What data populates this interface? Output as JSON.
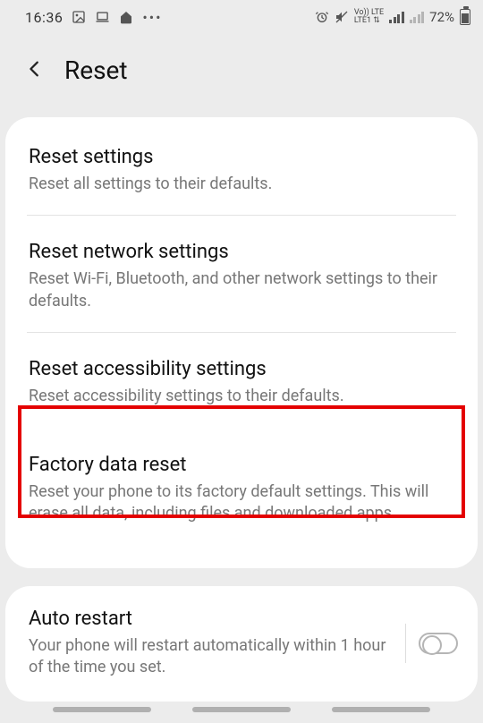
{
  "status": {
    "time": "16:36",
    "battery": "72%",
    "net_label": "Vo)) LTE LTE1"
  },
  "header": {
    "title": "Reset"
  },
  "rows": {
    "r0": {
      "title": "Reset settings",
      "desc": "Reset all settings to their defaults."
    },
    "r1": {
      "title": "Reset network settings",
      "desc": "Reset Wi-Fi, Bluetooth, and other network settings to their defaults."
    },
    "r2": {
      "title": "Reset accessibility settings",
      "desc": "Reset accessibility settings to their defaults."
    },
    "r3": {
      "title": "Factory data reset",
      "desc": "Reset your phone to its factory default settings. This will erase all data, including files and downloaded apps."
    }
  },
  "auto_restart": {
    "title": "Auto restart",
    "desc": "Your phone will restart automatically within 1 hour of the time you set."
  }
}
